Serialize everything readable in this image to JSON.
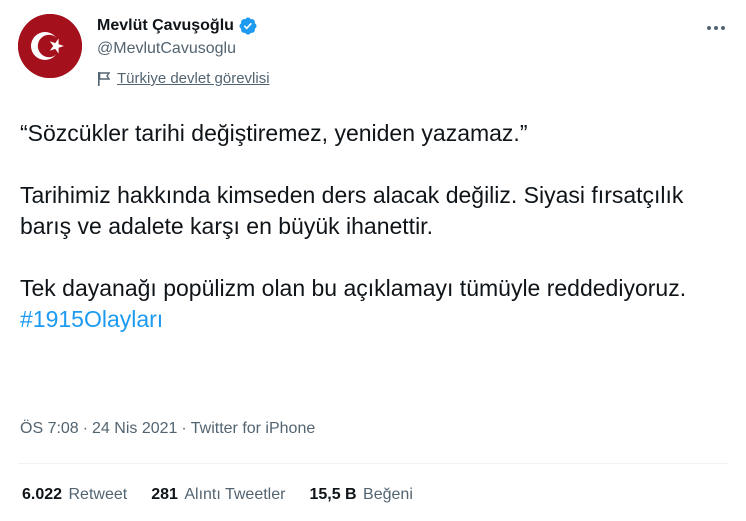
{
  "author": {
    "display_name": "Mevlüt Çavuşoğlu",
    "handle": "@MevlutCavusoglu",
    "label": "Türkiye devlet görevlisi",
    "avatar_icon": "turkish-flag-icon",
    "verified_color": "#1d9bf0"
  },
  "tweet": {
    "line1": "“Sözcükler tarihi değiştiremez, yeniden yazamaz.”",
    "line2": "Tarihimiz hakkında kimseden ders alacak değiliz. Siyasi fırsatçılık barış ve adalete karşı en büyük ihanettir.",
    "line3": "Tek dayanağı popülizm olan bu  açıklamayı tümüyle reddediyoruz.",
    "hashtag": "#1915Olayları"
  },
  "meta": {
    "time": "ÖS 7:08",
    "date": "24 Nis 2021",
    "source": "Twitter for iPhone",
    "separator": "·"
  },
  "stats": {
    "retweets_count": "6.022",
    "retweets_label": "Retweet",
    "quotes_count": "281",
    "quotes_label": "Alıntı Tweetler",
    "likes_count": "15,5 B",
    "likes_label": "Beğeni"
  },
  "colors": {
    "accent": "#1d9bf0",
    "secondary_text": "#536471",
    "avatar_red": "#a4101b"
  }
}
